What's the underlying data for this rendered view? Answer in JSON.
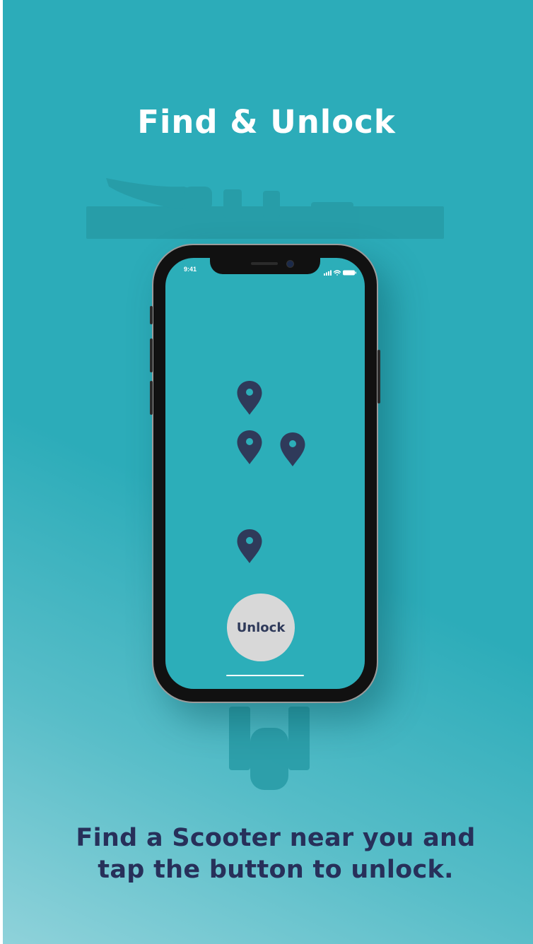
{
  "headline": "Find & Unlock",
  "phone": {
    "status_time": "9:41",
    "status_icons": [
      "signal-icon",
      "wifi-icon",
      "battery-icon"
    ],
    "map_pins": [
      "map-pin-icon",
      "map-pin-icon",
      "map-pin-icon",
      "map-pin-icon"
    ],
    "unlock_label": "Unlock"
  },
  "caption": {
    "line1": "Find a Scooter near you and",
    "line2": "tap the button to unlock."
  },
  "colors": {
    "background": "#2cacb9",
    "pin": "#2f3a5a",
    "caption": "#27305a",
    "button": "#d8d8d8"
  }
}
